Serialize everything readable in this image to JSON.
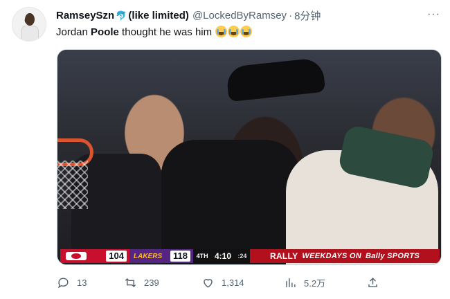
{
  "author": {
    "display_name": "RamseySzn",
    "badge_icon": "dolphin-emoji",
    "name_suffix": "(like limited)",
    "handle": "@LockedByRamsey",
    "separator": "·",
    "timestamp": "8分钟"
  },
  "tweet": {
    "text_before": "Jordan ",
    "text_bold": "Poole",
    "text_after": " thought he was him",
    "emojis": [
      "loudly-crying-face-emoji",
      "loudly-crying-face-emoji",
      "loudly-crying-face-emoji"
    ]
  },
  "media": {
    "scoreboard": {
      "team_a_logo": "hawks-logo",
      "team_a_score": "104",
      "team_b_logo": "LAKERS",
      "team_b_score": "118",
      "quarter": "4TH",
      "game_clock": "4:10",
      "shot_clock": ":24",
      "ad_brand": "RALLY",
      "ad_text": "WEEKDAYS ON",
      "ad_network": "Bally SPORTS"
    }
  },
  "actions": {
    "reply_count": "13",
    "retweet_count": "239",
    "like_count": "1,314",
    "views_count": "5.2万"
  },
  "colors": {
    "accent": "#1d9bf0",
    "secondary_text": "#536471",
    "hawks_red": "#c8102e",
    "lakers_purple": "#552583"
  }
}
